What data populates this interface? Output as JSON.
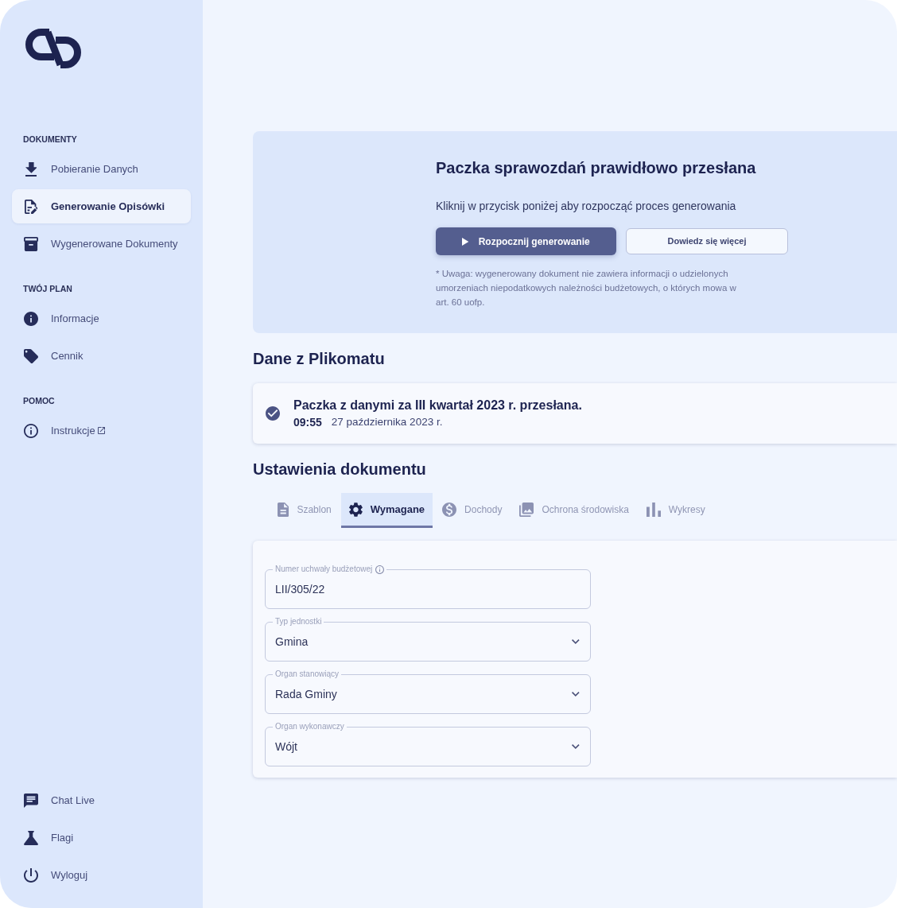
{
  "sidebar": {
    "sections": [
      {
        "heading": "DOKUMENTY",
        "items": [
          {
            "label": "Pobieranie Danych",
            "selected": false,
            "external": false
          },
          {
            "label": "Generowanie Opisówki",
            "selected": true,
            "external": false
          },
          {
            "label": "Wygenerowane Dokumenty",
            "selected": false,
            "external": false
          }
        ]
      },
      {
        "heading": "TWÓJ PLAN",
        "items": [
          {
            "label": "Informacje",
            "selected": false,
            "external": false
          },
          {
            "label": "Cennik",
            "selected": false,
            "external": false
          }
        ]
      },
      {
        "heading": "POMOC",
        "items": [
          {
            "label": "Instrukcje",
            "selected": false,
            "external": true
          }
        ]
      }
    ],
    "footer_items": [
      {
        "label": "Chat Live",
        "selected": false
      },
      {
        "label": "Flagi",
        "selected": false
      },
      {
        "label": "Wyloguj",
        "selected": false
      }
    ]
  },
  "upload_banner": {
    "title": "Paczka sprawozdań prawidłowo przesłana",
    "text": "Kliknij w przycisk poniżej aby rozpocząć proces generowania",
    "buttons": [
      {
        "label": "Rozpocznij generowanie",
        "kind": "primary"
      },
      {
        "label": "Dowiedz się więcej",
        "kind": "secondary"
      }
    ],
    "note": "* Uwaga: wygenerowany dokument nie zawiera informacji o udzielonych umorzeniach niepodatkowych należności budżetowych, o których mowa w art. 60 uofp."
  },
  "plikomat": {
    "heading": "Dane z Plikomatu",
    "status": {
      "title": "Paczka z danymi za III kwartał 2023 r. przesłana.",
      "time": "09:55",
      "date": "27 października 2023 r."
    }
  },
  "document_settings": {
    "heading": "Ustawienia dokumentu",
    "tabs": [
      {
        "label": "Szablon",
        "selected": false
      },
      {
        "label": "Wymagane",
        "selected": true
      },
      {
        "label": "Dochody",
        "selected": false
      },
      {
        "label": "Ochrona środowiska",
        "selected": false
      },
      {
        "label": "Wykresy",
        "selected": false
      }
    ],
    "fields": [
      {
        "label": "Numer uchwały budżetowej",
        "value": "LII/305/22",
        "kind": "text",
        "info": true
      },
      {
        "label": "Typ jednostki",
        "value": "Gmina",
        "kind": "select",
        "info": false
      },
      {
        "label": "Organ stanowiący",
        "value": "Rada Gminy",
        "kind": "select",
        "info": false
      },
      {
        "label": "Organ wykonawczy",
        "value": "Wójt",
        "kind": "select",
        "info": false
      }
    ]
  }
}
